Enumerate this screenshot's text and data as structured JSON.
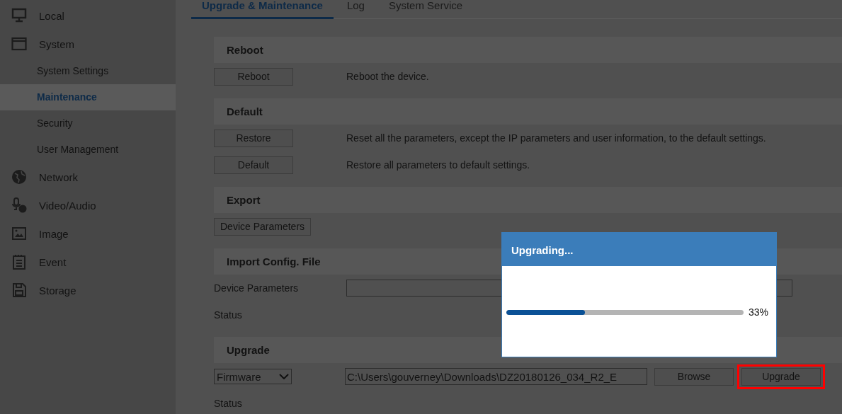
{
  "sidebar": {
    "items": [
      {
        "label": "Local",
        "kind": "monitor",
        "selected": false
      },
      {
        "label": "System",
        "kind": "window",
        "selected": false,
        "children": [
          {
            "label": "System Settings",
            "selected": false
          },
          {
            "label": "Maintenance",
            "selected": true
          },
          {
            "label": "Security",
            "selected": false
          },
          {
            "label": "User Management",
            "selected": false
          }
        ]
      },
      {
        "label": "Network",
        "kind": "globe",
        "selected": false
      },
      {
        "label": "Video/Audio",
        "kind": "mic",
        "selected": false
      },
      {
        "label": "Image",
        "kind": "image",
        "selected": false
      },
      {
        "label": "Event",
        "kind": "list",
        "selected": false
      },
      {
        "label": "Storage",
        "kind": "disk",
        "selected": false
      }
    ]
  },
  "tabs": [
    {
      "label": "Upgrade & Maintenance",
      "selected": true
    },
    {
      "label": "Log",
      "selected": false
    },
    {
      "label": "System Service",
      "selected": false
    }
  ],
  "sections": [
    {
      "title": "Reboot",
      "rows": [
        {
          "kind": "button",
          "button": "Reboot",
          "description": "Reboot the device."
        }
      ]
    },
    {
      "title": "Default",
      "rows": [
        {
          "kind": "button",
          "button": "Restore",
          "description": "Reset all the parameters, except the IP parameters and user information, to the default settings."
        },
        {
          "kind": "button",
          "button": "Default",
          "description": "Restore all parameters to default settings."
        }
      ]
    },
    {
      "title": "Export",
      "rows": [
        {
          "kind": "button",
          "button": "Device Parameters"
        }
      ]
    },
    {
      "title": "Import Config. File",
      "rows": [
        {
          "kind": "field",
          "label": "Device Parameters"
        },
        {
          "kind": "status",
          "label": "Status"
        }
      ]
    },
    {
      "title": "Upgrade",
      "rows": [
        {
          "kind": "upgrade",
          "select": "Firmware",
          "path": "C:\\Users\\gouverney\\Downloads\\DZ20180126_034_R2_E",
          "browse": "Browse",
          "upgrade": "Upgrade",
          "highlighted": true
        },
        {
          "kind": "status",
          "label": "Status"
        }
      ]
    }
  ],
  "dialog": {
    "title": "Upgrading...",
    "level": 0.33,
    "reading": "33%"
  }
}
